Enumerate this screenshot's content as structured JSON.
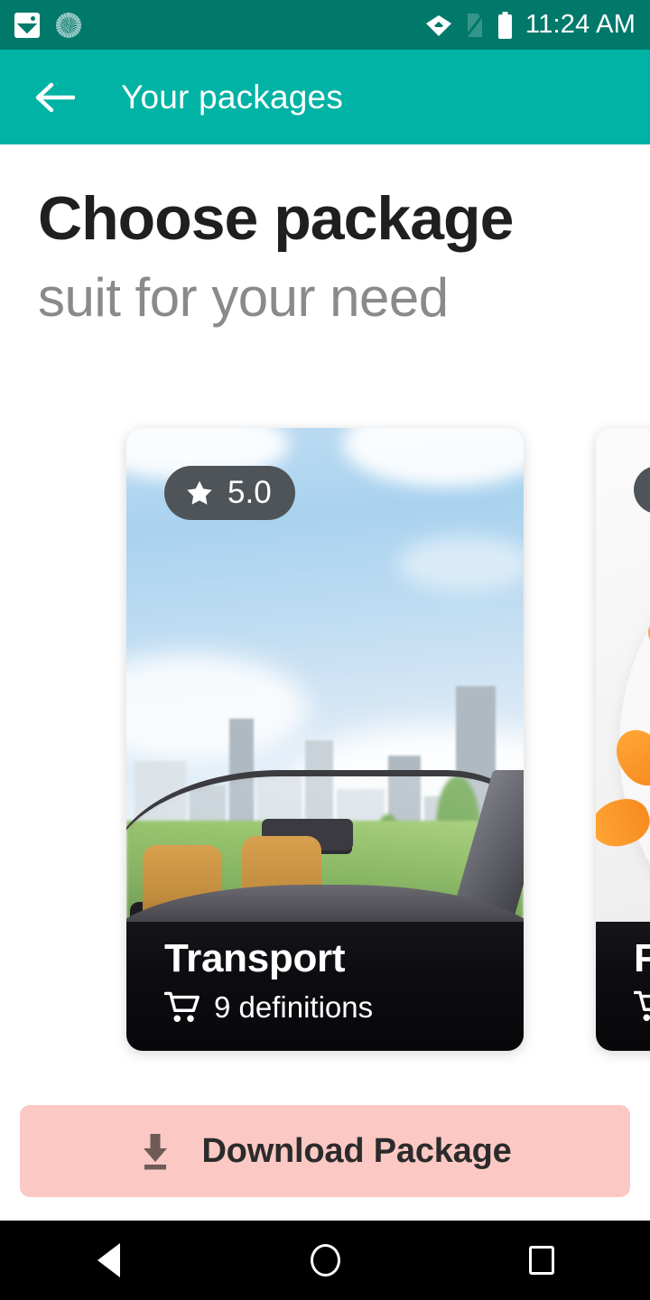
{
  "status_bar": {
    "time": "11:24 AM",
    "icons": [
      "image-icon",
      "sync-spinner-icon",
      "wifi-icon",
      "sim-off-icon",
      "battery-icon"
    ],
    "background": "#00796b"
  },
  "app_bar": {
    "back_icon": "back-arrow-icon",
    "title": "Your packages",
    "background": "#00b3a4"
  },
  "headings": {
    "title": "Choose package",
    "subtitle": "suit for your need",
    "title_color": "#1f1f1f",
    "subtitle_color": "#8a8a8a"
  },
  "cards": [
    {
      "rating": "5.0",
      "rating_icon": "star-icon",
      "title": "Transport",
      "meta_icon": "shopping-cart-icon",
      "meta": "9 definitions",
      "image": "convertible-car-city-skyline"
    },
    {
      "rating": "",
      "rating_icon": "star-icon",
      "title": "F",
      "meta_icon": "shopping-cart-icon",
      "meta": "",
      "image": "food-plate-carrot-flowers"
    }
  ],
  "download_button": {
    "label": "Download Package",
    "icon": "download-icon",
    "background": "#fbc8c3",
    "text_color": "#2b2b2b"
  },
  "nav_bar": {
    "back": "back-triangle-icon",
    "home": "home-circle-icon",
    "recents": "recents-square-icon",
    "background": "#000000"
  }
}
